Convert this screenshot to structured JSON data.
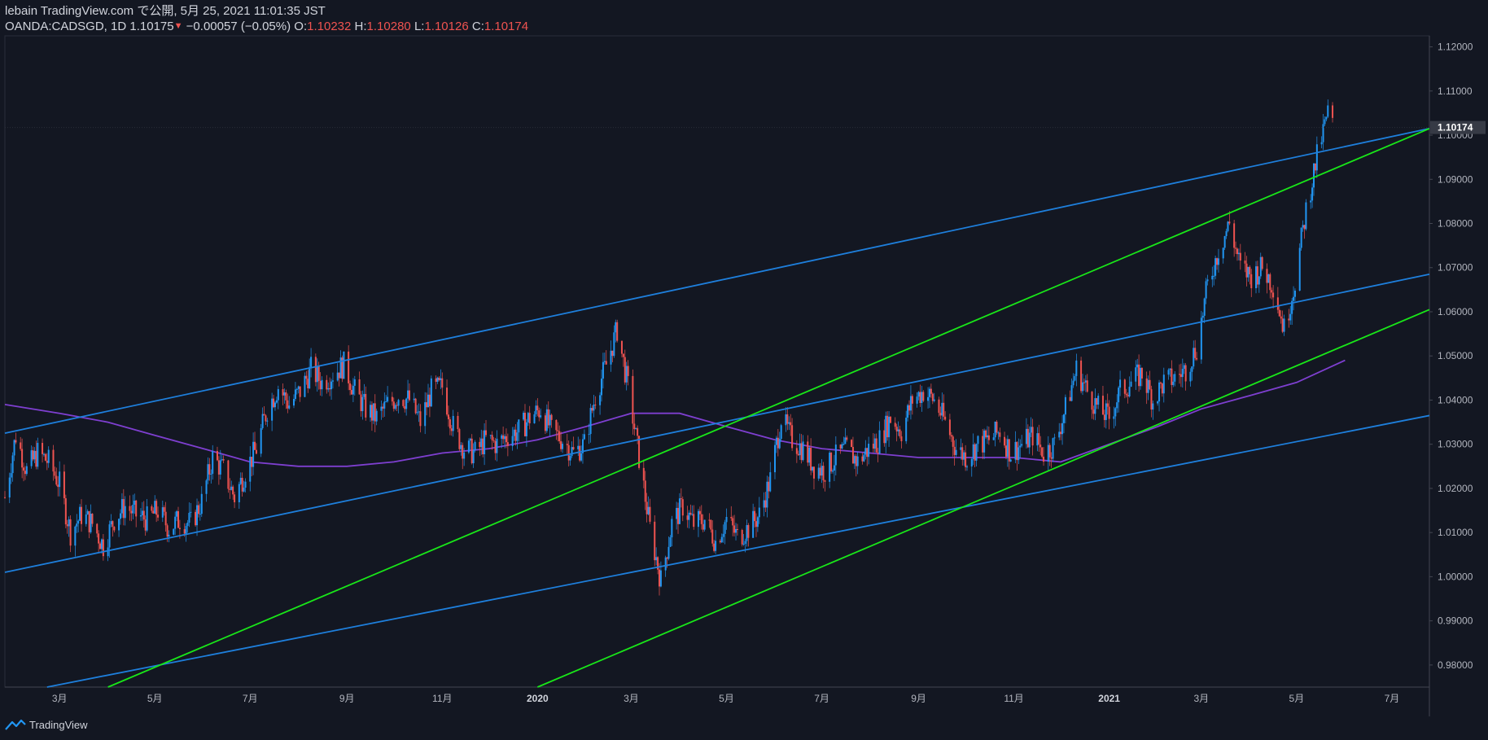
{
  "header": {
    "line1": "lebain TradingView.com で公開, 5月 25, 2021 11:01:35 JST",
    "symbol": "OANDA:CADSGD, 1D",
    "last": "1.10175",
    "arrow": "▼",
    "change": "−0.00057 (−0.05%)",
    "o_label": "O:",
    "o_val": "1.10232",
    "h_label": "H:",
    "h_val": "1.10280",
    "l_label": "L:",
    "l_val": "1.10126",
    "c_label": "C:",
    "c_val": "1.10174"
  },
  "footer": {
    "brand": "TradingView"
  },
  "colors": {
    "background": "#131722",
    "up": "#2196f3",
    "down": "#ef5350",
    "channel_blue": "#1e7fdc",
    "channel_green": "#19e619",
    "ma": "#7e3fd0",
    "last_price_label": "#363a45"
  },
  "chart_data": {
    "type": "candlestick",
    "symbol": "OANDA:CADSGD",
    "timeframe": "1D",
    "y_range": [
      0.975,
      1.1225
    ],
    "y_ticks": [
      0.98,
      0.99,
      1.0,
      1.01,
      1.02,
      1.03,
      1.04,
      1.05,
      1.06,
      1.07,
      1.08,
      1.09,
      1.1,
      1.11,
      1.12
    ],
    "y_tick_labels": [
      "0.98000",
      "0.99000",
      "1.00000",
      "1.01000",
      "1.02000",
      "1.03000",
      "1.04000",
      "1.05000",
      "1.06000",
      "1.07000",
      "1.08000",
      "1.09000",
      "1.10000",
      "1.11000",
      "1.12000"
    ],
    "x_labels": [
      {
        "label": "3月",
        "date": "2019-03-01",
        "bold": false
      },
      {
        "label": "5月",
        "date": "2019-05-01",
        "bold": false
      },
      {
        "label": "7月",
        "date": "2019-07-01",
        "bold": false
      },
      {
        "label": "9月",
        "date": "2019-09-01",
        "bold": false
      },
      {
        "label": "11月",
        "date": "2019-11-01",
        "bold": false
      },
      {
        "label": "2020",
        "date": "2020-01-01",
        "bold": true
      },
      {
        "label": "3月",
        "date": "2020-03-01",
        "bold": false
      },
      {
        "label": "5月",
        "date": "2020-05-01",
        "bold": false
      },
      {
        "label": "7月",
        "date": "2020-07-01",
        "bold": false
      },
      {
        "label": "9月",
        "date": "2020-09-01",
        "bold": false
      },
      {
        "label": "11月",
        "date": "2020-11-01",
        "bold": false
      },
      {
        "label": "2021",
        "date": "2021-01-01",
        "bold": true
      },
      {
        "label": "3月",
        "date": "2021-03-01",
        "bold": false
      },
      {
        "label": "5月",
        "date": "2021-05-01",
        "bold": false
      },
      {
        "label": "7月",
        "date": "2021-07-01",
        "bold": false
      }
    ],
    "last_price_label": "1.10174",
    "last_price": 1.10174,
    "close_path": [
      [
        "2019-01-25",
        1.018
      ],
      [
        "2019-02-01",
        1.032
      ],
      [
        "2019-02-08",
        1.024
      ],
      [
        "2019-02-15",
        1.028
      ],
      [
        "2019-02-22",
        1.026
      ],
      [
        "2019-03-01",
        1.021
      ],
      [
        "2019-03-08",
        1.01
      ],
      [
        "2019-03-15",
        1.014
      ],
      [
        "2019-03-22",
        1.012
      ],
      [
        "2019-03-29",
        1.007
      ],
      [
        "2019-04-05",
        1.013
      ],
      [
        "2019-04-12",
        1.016
      ],
      [
        "2019-04-19",
        1.014
      ],
      [
        "2019-04-26",
        1.013
      ],
      [
        "2019-05-03",
        1.015
      ],
      [
        "2019-05-10",
        1.011
      ],
      [
        "2019-05-17",
        1.013
      ],
      [
        "2019-05-24",
        1.012
      ],
      [
        "2019-05-31",
        1.017
      ],
      [
        "2019-06-07",
        1.027
      ],
      [
        "2019-06-14",
        1.024
      ],
      [
        "2019-06-21",
        1.018
      ],
      [
        "2019-06-28",
        1.024
      ],
      [
        "2019-07-05",
        1.029
      ],
      [
        "2019-07-12",
        1.038
      ],
      [
        "2019-07-19",
        1.043
      ],
      [
        "2019-07-26",
        1.039
      ],
      [
        "2019-08-02",
        1.042
      ],
      [
        "2019-08-09",
        1.047
      ],
      [
        "2019-08-16",
        1.044
      ],
      [
        "2019-08-23",
        1.046
      ],
      [
        "2019-08-30",
        1.048
      ],
      [
        "2019-09-06",
        1.042
      ],
      [
        "2019-09-13",
        1.038
      ],
      [
        "2019-09-20",
        1.036
      ],
      [
        "2019-09-27",
        1.039
      ],
      [
        "2019-10-04",
        1.041
      ],
      [
        "2019-10-11",
        1.04
      ],
      [
        "2019-10-18",
        1.035
      ],
      [
        "2019-10-25",
        1.042
      ],
      [
        "2019-11-01",
        1.043
      ],
      [
        "2019-11-08",
        1.034
      ],
      [
        "2019-11-15",
        1.029
      ],
      [
        "2019-11-22",
        1.028
      ],
      [
        "2019-11-29",
        1.031
      ],
      [
        "2019-12-06",
        1.03
      ],
      [
        "2019-12-13",
        1.032
      ],
      [
        "2019-12-20",
        1.033
      ],
      [
        "2019-12-27",
        1.036
      ],
      [
        "2020-01-03",
        1.038
      ],
      [
        "2020-01-10",
        1.033
      ],
      [
        "2020-01-17",
        1.031
      ],
      [
        "2020-01-24",
        1.028
      ],
      [
        "2020-01-31",
        1.03
      ],
      [
        "2020-02-07",
        1.041
      ],
      [
        "2020-02-14",
        1.048
      ],
      [
        "2020-02-21",
        1.056
      ],
      [
        "2020-02-28",
        1.043
      ],
      [
        "2020-03-06",
        1.027
      ],
      [
        "2020-03-13",
        1.011
      ],
      [
        "2020-03-20",
        0.999
      ],
      [
        "2020-03-27",
        1.012
      ],
      [
        "2020-04-03",
        1.016
      ],
      [
        "2020-04-10",
        1.012
      ],
      [
        "2020-04-17",
        1.013
      ],
      [
        "2020-04-24",
        1.008
      ],
      [
        "2020-05-01",
        1.013
      ],
      [
        "2020-05-08",
        1.009
      ],
      [
        "2020-05-15",
        1.011
      ],
      [
        "2020-05-22",
        1.014
      ],
      [
        "2020-05-29",
        1.022
      ],
      [
        "2020-06-05",
        1.036
      ],
      [
        "2020-06-12",
        1.031
      ],
      [
        "2020-06-19",
        1.029
      ],
      [
        "2020-06-26",
        1.025
      ],
      [
        "2020-07-03",
        1.024
      ],
      [
        "2020-07-10",
        1.027
      ],
      [
        "2020-07-17",
        1.029
      ],
      [
        "2020-07-24",
        1.026
      ],
      [
        "2020-07-31",
        1.029
      ],
      [
        "2020-08-07",
        1.031
      ],
      [
        "2020-08-14",
        1.036
      ],
      [
        "2020-08-21",
        1.033
      ],
      [
        "2020-08-28",
        1.04
      ],
      [
        "2020-09-04",
        1.042
      ],
      [
        "2020-09-11",
        1.04
      ],
      [
        "2020-09-18",
        1.035
      ],
      [
        "2020-09-25",
        1.029
      ],
      [
        "2020-10-02",
        1.027
      ],
      [
        "2020-10-09",
        1.03
      ],
      [
        "2020-10-16",
        1.031
      ],
      [
        "2020-10-23",
        1.033
      ],
      [
        "2020-10-30",
        1.028
      ],
      [
        "2020-11-06",
        1.03
      ],
      [
        "2020-11-13",
        1.032
      ],
      [
        "2020-11-20",
        1.028
      ],
      [
        "2020-11-27",
        1.03
      ],
      [
        "2020-12-04",
        1.038
      ],
      [
        "2020-12-11",
        1.047
      ],
      [
        "2020-12-18",
        1.042
      ],
      [
        "2020-12-25",
        1.038
      ],
      [
        "2021-01-01",
        1.036
      ],
      [
        "2021-01-08",
        1.042
      ],
      [
        "2021-01-15",
        1.044
      ],
      [
        "2021-01-22",
        1.046
      ],
      [
        "2021-01-29",
        1.04
      ],
      [
        "2021-02-05",
        1.044
      ],
      [
        "2021-02-12",
        1.045
      ],
      [
        "2021-02-19",
        1.047
      ],
      [
        "2021-02-26",
        1.052
      ],
      [
        "2021-03-05",
        1.066
      ],
      [
        "2021-03-12",
        1.074
      ],
      [
        "2021-03-19",
        1.08
      ],
      [
        "2021-03-26",
        1.07
      ],
      [
        "2021-04-02",
        1.068
      ],
      [
        "2021-04-09",
        1.07
      ],
      [
        "2021-04-16",
        1.066
      ],
      [
        "2021-04-23",
        1.056
      ],
      [
        "2021-04-30",
        1.067
      ],
      [
        "2021-05-07",
        1.083
      ],
      [
        "2021-05-14",
        1.095
      ],
      [
        "2021-05-21",
        1.105
      ],
      [
        "2021-05-25",
        1.10174
      ]
    ],
    "moving_average": [
      [
        "2019-01-25",
        1.039
      ],
      [
        "2019-03-01",
        1.037
      ],
      [
        "2019-04-01",
        1.035
      ],
      [
        "2019-05-01",
        1.032
      ],
      [
        "2019-06-01",
        1.029
      ],
      [
        "2019-07-01",
        1.026
      ],
      [
        "2019-08-01",
        1.025
      ],
      [
        "2019-09-01",
        1.025
      ],
      [
        "2019-10-01",
        1.026
      ],
      [
        "2019-11-01",
        1.028
      ],
      [
        "2019-12-01",
        1.029
      ],
      [
        "2020-01-01",
        1.031
      ],
      [
        "2020-02-01",
        1.034
      ],
      [
        "2020-03-01",
        1.037
      ],
      [
        "2020-04-01",
        1.037
      ],
      [
        "2020-05-01",
        1.034
      ],
      [
        "2020-06-01",
        1.031
      ],
      [
        "2020-07-01",
        1.029
      ],
      [
        "2020-08-01",
        1.028
      ],
      [
        "2020-09-01",
        1.027
      ],
      [
        "2020-10-01",
        1.027
      ],
      [
        "2020-11-01",
        1.027
      ],
      [
        "2020-12-01",
        1.026
      ],
      [
        "2021-01-01",
        1.03
      ],
      [
        "2021-02-01",
        1.034
      ],
      [
        "2021-03-01",
        1.038
      ],
      [
        "2021-04-01",
        1.041
      ],
      [
        "2021-05-01",
        1.044
      ],
      [
        "2021-06-01",
        1.049
      ]
    ],
    "trendlines": [
      {
        "color": "blue",
        "from": [
          "2019-01-25",
          1.0325
        ],
        "to": [
          "2021-07-25",
          1.1015
        ]
      },
      {
        "color": "blue",
        "from": [
          "2019-01-25",
          1.001
        ],
        "to": [
          "2021-07-25",
          1.0685
        ]
      },
      {
        "color": "blue",
        "from": [
          "2019-02-21",
          0.975
        ],
        "to": [
          "2021-07-25",
          1.0365
        ]
      },
      {
        "color": "green",
        "from": [
          "2019-04-01",
          0.975
        ],
        "to": [
          "2021-07-25",
          1.1015
        ]
      },
      {
        "color": "green",
        "from": [
          "2020-01-01",
          0.975
        ],
        "to": [
          "2021-07-25",
          1.0605
        ]
      }
    ]
  }
}
